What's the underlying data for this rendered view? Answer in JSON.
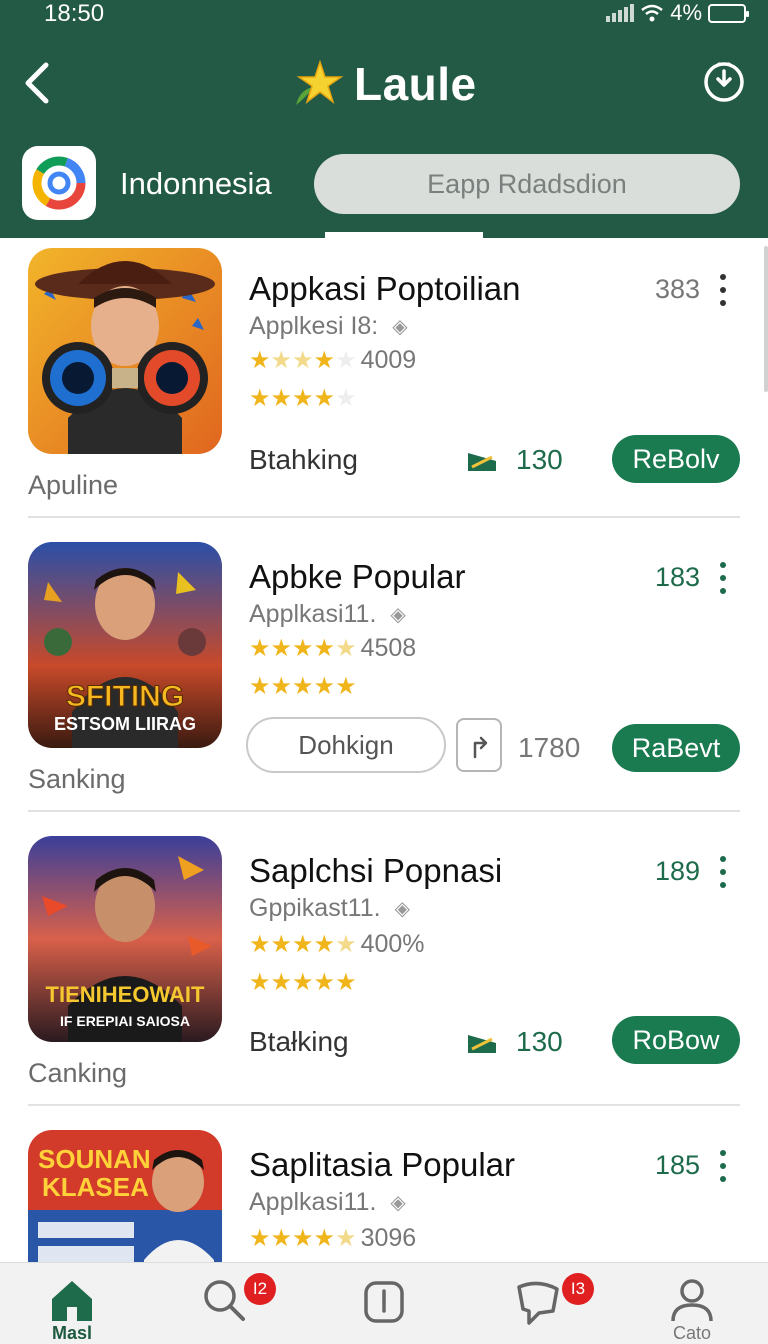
{
  "status_bar": {
    "time": "18:50",
    "battery": "4%"
  },
  "header": {
    "title": "Laule",
    "country": "Indonnesia",
    "search_placeholder": "Eapp Rdadsdion"
  },
  "apps": [
    {
      "name": "Appkasi Poptoilian",
      "count": "383",
      "subtitle": "Applkesi I8:",
      "rating_text": "4009",
      "rating1": [
        1,
        0.5,
        0.5,
        1,
        0
      ],
      "rating2": [
        1,
        1,
        1,
        1,
        0
      ],
      "category": "Apuline",
      "action_label": "Btahking",
      "downloads": "130",
      "button": "ReBolv",
      "thumb_caption": ""
    },
    {
      "name": "Apbke Popular",
      "count": "183",
      "subtitle": "Applkasi11.",
      "rating_text": "4508",
      "rating1": [
        1,
        1,
        1,
        1,
        0.5
      ],
      "rating2": [
        1,
        1,
        1,
        1,
        1
      ],
      "category": "Sanking",
      "outline_button": "Dohkign",
      "downloads": "1780",
      "button": "RaBevt",
      "thumb_caption": "SFITING",
      "thumb_caption2": "ESTSOM LIIRAG"
    },
    {
      "name": "Saplchsi Popnasi",
      "count": "189",
      "subtitle": "Gppikast11.",
      "rating_text": "400%",
      "rating1": [
        1,
        1,
        1,
        1,
        0.5
      ],
      "rating2": [
        1,
        1,
        1,
        1,
        1
      ],
      "category": "Canking",
      "action_label": "Btałking",
      "downloads": "130",
      "button": "RoBow",
      "thumb_caption": "TIENIHEOWAIT",
      "thumb_caption2": "IF EREPIAI SAIOSA"
    },
    {
      "name": "Saplitasia Popular",
      "count": "185",
      "subtitle": "Applkasi11.",
      "rating_text": "3096",
      "rating1": [
        1,
        1,
        1,
        1,
        0.5
      ],
      "thumb_caption": "SOUNAN",
      "thumb_caption2": "KLASEA"
    }
  ],
  "bottom_nav": [
    {
      "label": "Masl",
      "icon": "home-icon",
      "badge": ""
    },
    {
      "label": "",
      "icon": "search-icon",
      "badge": "I2"
    },
    {
      "label": "",
      "icon": "phone-icon",
      "badge": ""
    },
    {
      "label": "",
      "icon": "chat-icon",
      "badge": "I3"
    },
    {
      "label": "Cato",
      "icon": "profile-icon",
      "badge": ""
    }
  ],
  "colors": {
    "header_bg": "#235a45",
    "accent": "#1a7a50",
    "badge": "#e02020",
    "star": "#f1b51c"
  }
}
